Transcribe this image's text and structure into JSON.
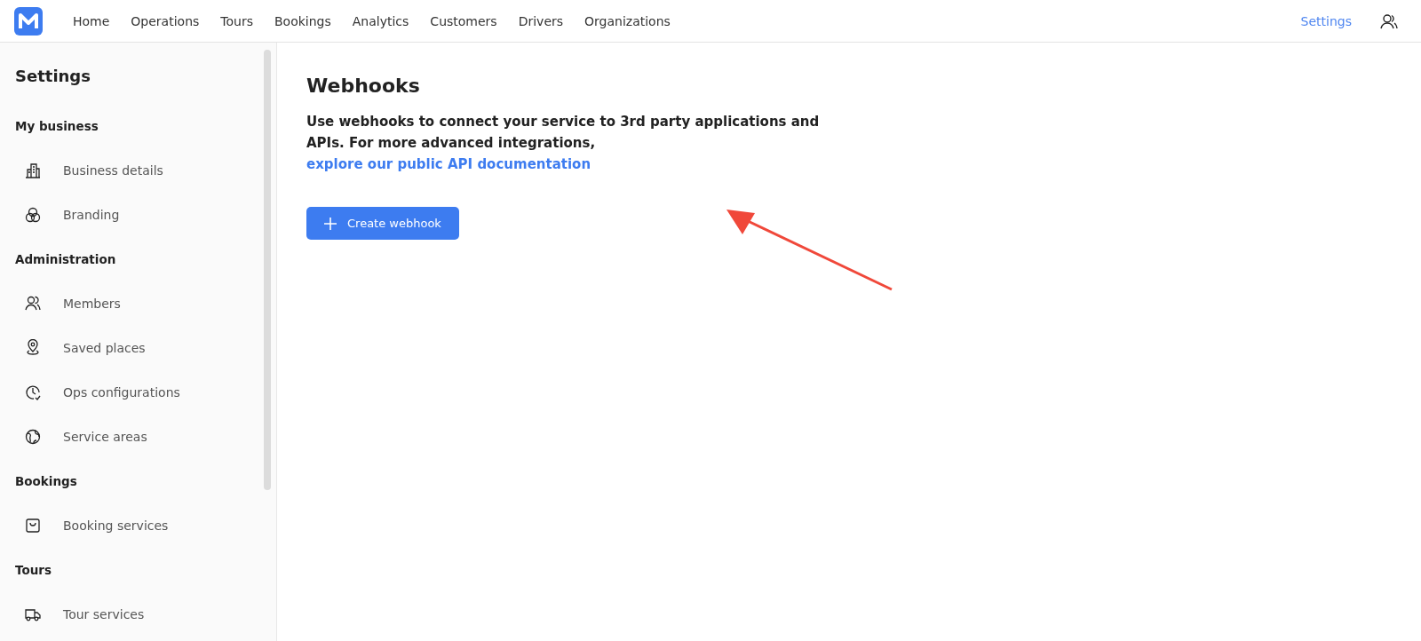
{
  "nav": {
    "items": [
      {
        "label": "Home",
        "selected": false
      },
      {
        "label": "Operations",
        "selected": false
      },
      {
        "label": "Tours",
        "selected": false
      },
      {
        "label": "Bookings",
        "selected": false
      },
      {
        "label": "Analytics",
        "selected": false
      },
      {
        "label": "Customers",
        "selected": false
      },
      {
        "label": "Drivers",
        "selected": false
      },
      {
        "label": "Organizations",
        "selected": false
      }
    ],
    "settings": {
      "label": "Settings",
      "selected": true
    }
  },
  "sidebar": {
    "title": "Settings",
    "sections": [
      {
        "heading": "My business",
        "items": [
          "Business details",
          "Branding"
        ]
      },
      {
        "heading": "Administration",
        "items": [
          "Members",
          "Saved places",
          "Ops configurations",
          "Service areas"
        ]
      },
      {
        "heading": "Bookings",
        "items": [
          "Booking services"
        ]
      },
      {
        "heading": "Tours",
        "items": [
          "Tour services"
        ]
      }
    ]
  },
  "main": {
    "title": "Webhooks",
    "description": "Use webhooks to connect your service to 3rd party applications and APIs. For more advanced integrations,",
    "link": "explore our public API documentation",
    "button": "Create webhook"
  }
}
